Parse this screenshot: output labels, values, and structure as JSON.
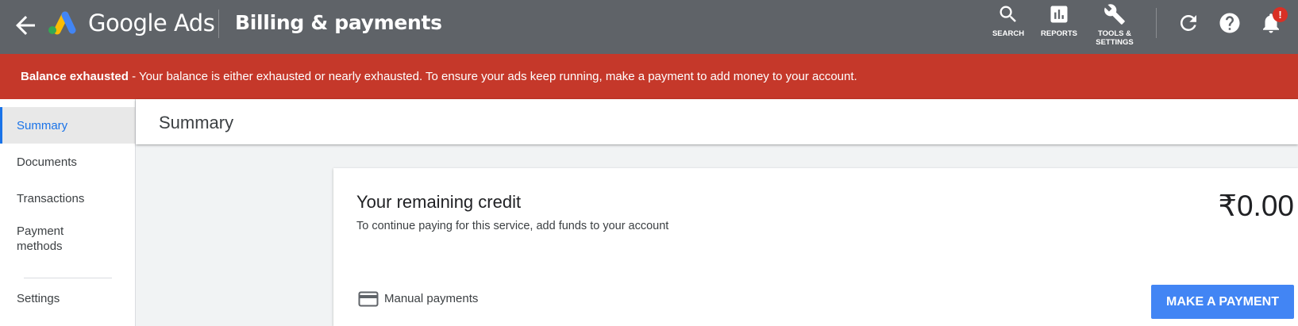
{
  "header": {
    "brand": "Google Ads",
    "page_title": "Billing & payments",
    "nav": [
      {
        "label": "SEARCH",
        "icon": "search-icon"
      },
      {
        "label": "REPORTS",
        "icon": "reports-icon"
      },
      {
        "label_line1": "TOOLS &",
        "label_line2": "SETTINGS",
        "icon": "wrench-icon"
      }
    ],
    "notification_badge": "!"
  },
  "alert": {
    "title": "Balance exhausted",
    "message": " - Your balance is either exhausted or nearly exhausted. To ensure your ads keep running, make a payment to add money to your account."
  },
  "sidebar": {
    "items": [
      {
        "label": "Summary",
        "active": true
      },
      {
        "label": "Documents"
      },
      {
        "label": "Transactions"
      },
      {
        "label_line1": "Payment",
        "label_line2": "methods"
      },
      {
        "label": "Settings"
      }
    ]
  },
  "summary": {
    "header": "Summary",
    "card": {
      "title": "Your remaining credit",
      "subtitle": "To continue paying for this service, add funds to your account",
      "amount": "₹0.00",
      "payment_type": "Manual payments",
      "button": "MAKE A PAYMENT"
    }
  },
  "colors": {
    "topbar": "#5f6368",
    "alert": "#c5382a",
    "accent": "#1a73e8",
    "button": "#4285f4",
    "badge": "#d93025"
  }
}
